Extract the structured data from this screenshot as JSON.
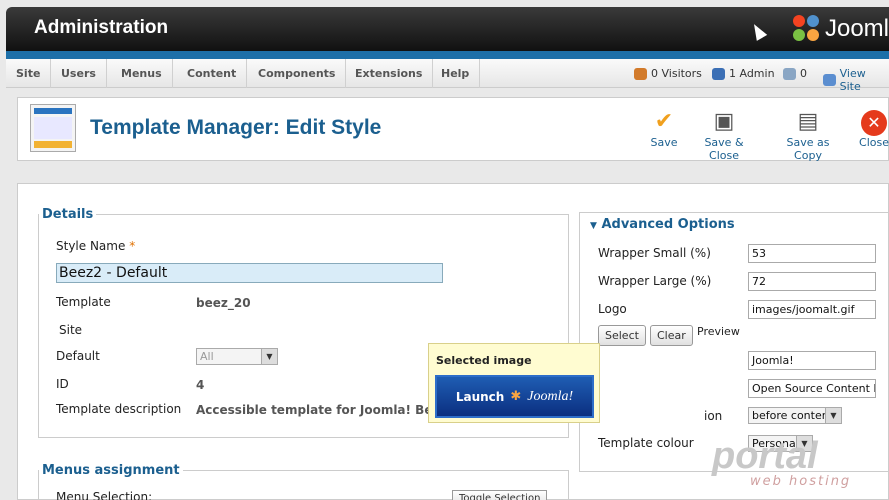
{
  "header": {
    "title": "Administration",
    "logo_text": "Jooml"
  },
  "menu": [
    {
      "label": "Site"
    },
    {
      "label": "Users"
    },
    {
      "label": "Menus"
    },
    {
      "label": "Content"
    },
    {
      "label": "Components"
    },
    {
      "label": "Extensions"
    },
    {
      "label": "Help"
    }
  ],
  "status": {
    "visitors": "0 Visitors",
    "admin": "1 Admin",
    "messages": "0",
    "view_site": "View Site"
  },
  "toolbar": {
    "title": "Template Manager: Edit Style",
    "save": "Save",
    "save_close": "Save & Close",
    "save_copy": "Save as Copy",
    "close": "Close"
  },
  "details": {
    "legend": "Details",
    "style_name_label": "Style Name",
    "required_mark": "*",
    "style_name_value": "Beez2 - Default",
    "template_label": "Template",
    "template_value": "beez_20",
    "site_label": "Site",
    "default_label": "Default",
    "default_value": "All",
    "id_label": "ID",
    "id_value": "4",
    "desc_label": "Template description",
    "desc_value": "Accessible template for Joomla! Beez, the"
  },
  "menus_assignment": {
    "legend": "Menus assignment",
    "menu_selection_label": "Menu Selection:",
    "toggle": "Toggle Selection"
  },
  "advanced": {
    "title": "Advanced Options",
    "wrapper_small_label": "Wrapper Small (%)",
    "wrapper_small_value": "53",
    "wrapper_large_label": "Wrapper Large (%)",
    "wrapper_large_value": "72",
    "logo_label": "Logo",
    "logo_value": "images/joomalt.gif",
    "select_btn": "Select",
    "clear_btn": "Clear",
    "preview_label": "Preview",
    "site_title_value": "Joomla!",
    "site_desc_value": "Open Source Content Man",
    "position_label_partial": "ion",
    "position_value": "before content",
    "colour_label": "Template colour",
    "colour_value": "Personal"
  },
  "tooltip": {
    "title": "Selected image",
    "launch_text": "Launch",
    "launch_brand": "Joomla!"
  },
  "watermark": {
    "main": "portal",
    "sub": "web hosting"
  },
  "colors": {
    "accent": "#1b5f8f",
    "bluebar": "#1d6fa8",
    "save_check": "#f0a01e",
    "close_red": "#e53a1c"
  }
}
